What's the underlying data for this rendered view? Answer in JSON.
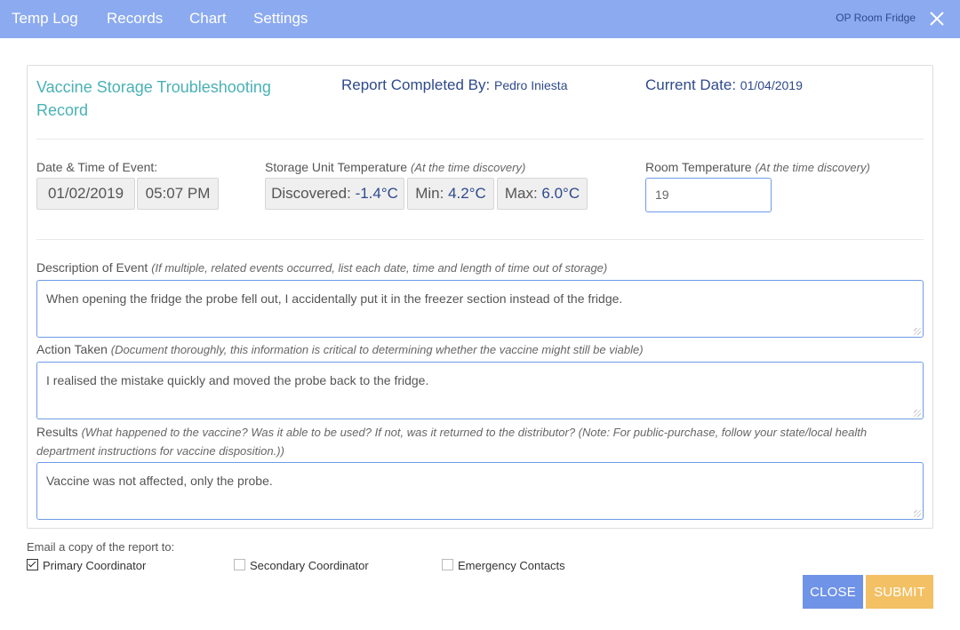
{
  "nav": {
    "items": [
      "Temp Log",
      "Records",
      "Chart",
      "Settings"
    ],
    "fridge_name": "OP Room Fridge"
  },
  "header": {
    "title": "Vaccine Storage Troubleshooting Record",
    "completed_by_label": "Report Completed By:",
    "completed_by_value": "Pedro Iniesta",
    "current_date_label": "Current Date:",
    "current_date_value": "01/04/2019"
  },
  "event": {
    "date_time_label": "Date & Time of Event:",
    "date": "01/02/2019",
    "time": "05:07 PM"
  },
  "storage_temp": {
    "label": "Storage Unit Temperature",
    "hint": "(At the time discovery)",
    "discovered_label": "Discovered:",
    "discovered_value": "-1.4°C",
    "min_label": "Min:",
    "min_value": "4.2°C",
    "max_label": "Max:",
    "max_value": "6.0°C"
  },
  "room_temp": {
    "label": "Room Temperature",
    "hint": "(At the time discovery)",
    "value": "19"
  },
  "description": {
    "label": "Description of Event",
    "hint": "(If multiple, related events occurred, list each date, time and length of time out of storage)",
    "value": "When opening the fridge the probe fell out, I accidentally put it in the freezer section instead of the fridge."
  },
  "action": {
    "label": "Action Taken",
    "hint": "(Document thoroughly, this information is critical to determining whether the vaccine might still be viable)",
    "value": "I realised the mistake quickly and moved the probe back to the fridge."
  },
  "results": {
    "label": "Results",
    "hint": "(What happened to the vaccine? Was it able to be used? If not, was it returned to the distributor? (Note: For public-purchase, follow your state/local health department instructions for vaccine disposition.))",
    "value": "Vaccine was not affected, only the probe."
  },
  "email": {
    "label": "Email a copy of the report to:",
    "options": [
      {
        "label": "Primary Coordinator",
        "checked": true
      },
      {
        "label": "Secondary Coordinator",
        "checked": false
      },
      {
        "label": "Emergency Contacts",
        "checked": false
      }
    ]
  },
  "buttons": {
    "close": "CLOSE",
    "submit": "SUBMIT"
  },
  "colors": {
    "topbar": "#8caaf0",
    "title": "#4ab1b5",
    "value_text": "#2e4a8c",
    "close_button": "#6f93e6",
    "submit_button": "#f3c064"
  }
}
